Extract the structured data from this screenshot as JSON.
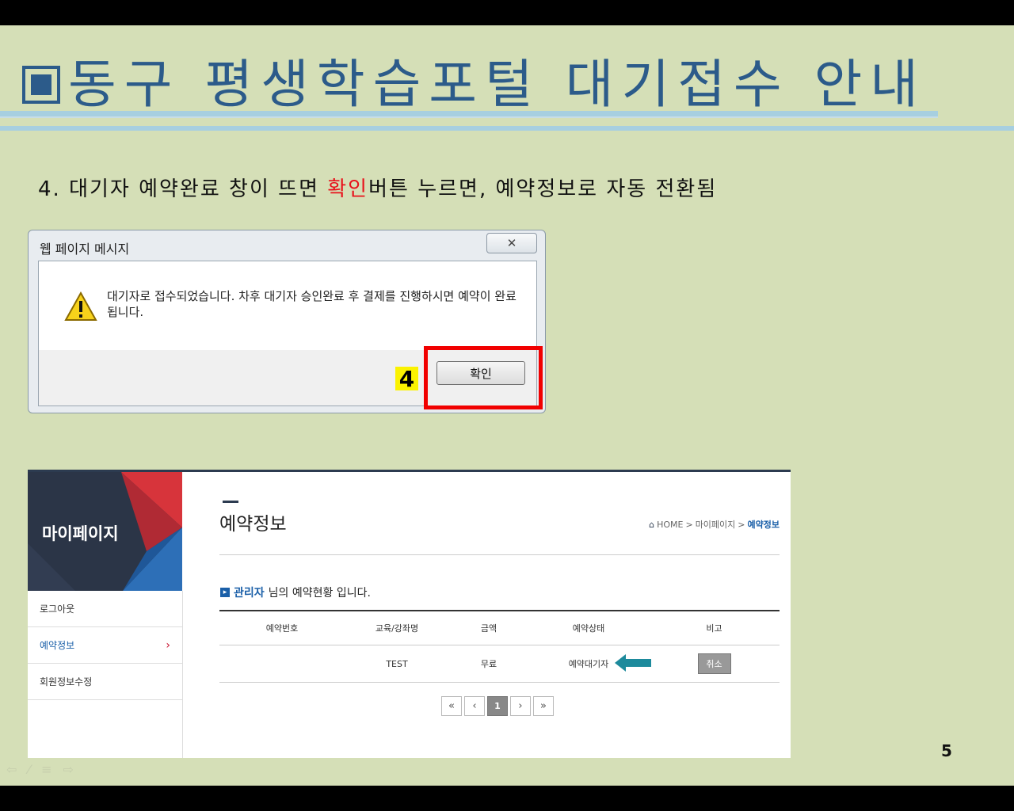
{
  "slide": {
    "title": "동구 평생학습포털 대기접수 안내",
    "step_prefix": "4. 대기자 예약완료 창이 뜨면 ",
    "step_highlight": "확인",
    "step_suffix": "버튼 누르면, 예약정보로 자동 전환됨",
    "page_number": "5"
  },
  "dialog": {
    "title": "웹 페이지 메시지",
    "close_symbol": "✕",
    "message": "대기자로 접수되었습니다. 차후 대기자 승인완료 후 결제를 진행하시면 예약이 완료됩니다.",
    "ok_label": "확인",
    "badge": "4"
  },
  "web": {
    "sidebar_title": "마이페이지",
    "menu": [
      {
        "label": "로그아웃"
      },
      {
        "label": "예약정보",
        "chevron": "›"
      },
      {
        "label": "회원정보수정"
      }
    ],
    "page_title": "예약정보",
    "breadcrumb": {
      "home": "HOME",
      "sep": ">",
      "level1": "마이페이지",
      "current": "예약정보"
    },
    "greeting": {
      "name": "관리자",
      "text": "님의 예약현황 입니다."
    },
    "table": {
      "headers": [
        "예약번호",
        "교육/강좌명",
        "금액",
        "예약상태",
        "비고"
      ],
      "row": {
        "number": "",
        "course": "TEST",
        "price": "무료",
        "status": "예약대기자",
        "action": "취소"
      }
    },
    "pager": {
      "first": "«",
      "prev": "‹",
      "page": "1",
      "next": "›",
      "last": "»"
    }
  }
}
